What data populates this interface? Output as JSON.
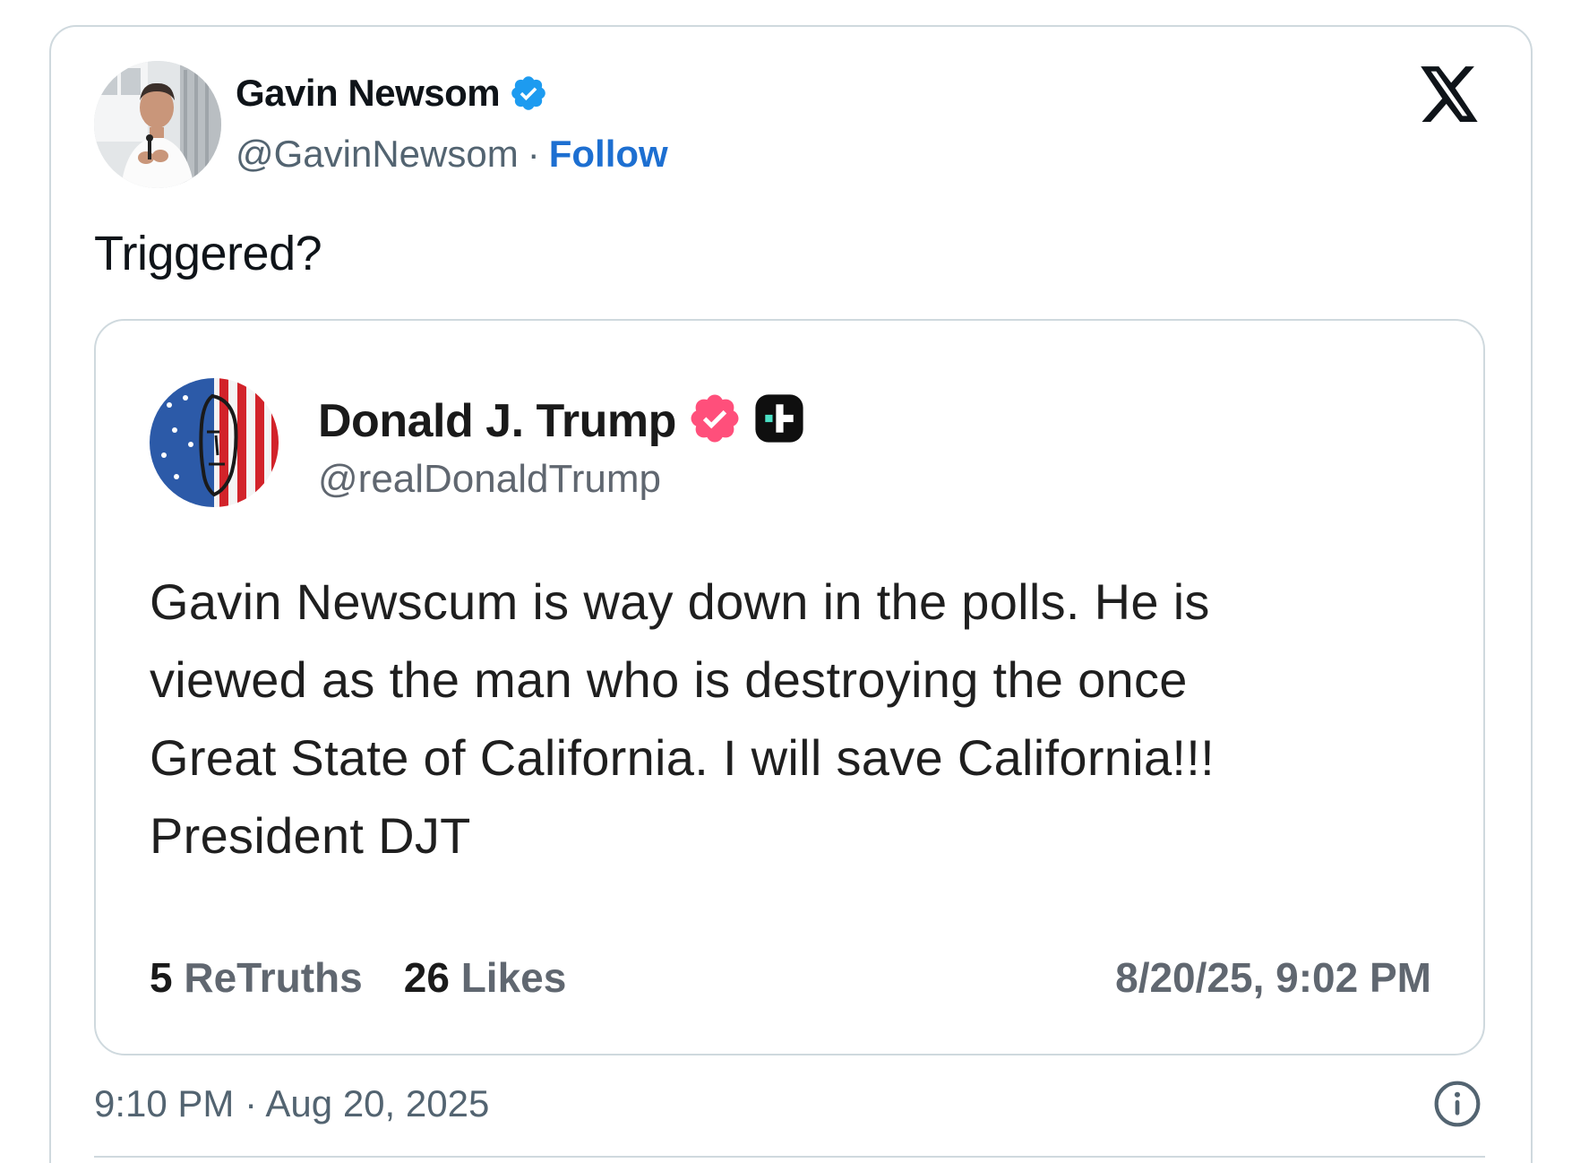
{
  "author": {
    "name": "Gavin Newsom",
    "handle": "@GavinNewsom",
    "separator": "·",
    "follow_label": "Follow",
    "verified_color": "#1d9bf0"
  },
  "tweet": {
    "text": "Triggered?",
    "timestamp": "9:10 PM · Aug 20, 2025"
  },
  "quoted_post": {
    "name": "Donald J. Trump",
    "handle": "@realDonaldTrump",
    "verified_color": "#ff4f7b",
    "body_lines": [
      "Gavin Newscum is way down in the polls. He is",
      "viewed as the man who is destroying the once",
      "Great State of California. I will save California!!!",
      "President DJT"
    ],
    "retruths_count": "5",
    "retruths_label": "ReTruths",
    "likes_count": "26",
    "likes_label": "Likes",
    "date": "8/20/25, 9:02 PM"
  },
  "icons": {
    "platform_logo": "x-logo-icon",
    "verified": "verified-badge-icon",
    "truth_plus": "truth-plus-icon",
    "info": "info-icon"
  }
}
